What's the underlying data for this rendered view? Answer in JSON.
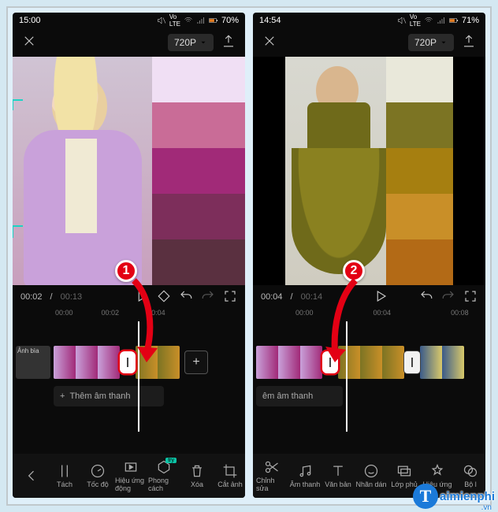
{
  "left": {
    "status": {
      "time": "15:00",
      "battery": "70%"
    },
    "header": {
      "resolution": "720P"
    },
    "swatches": [
      "#f0dff4",
      "#c96c97",
      "#a12a78",
      "#7d2e5b",
      "#5a3040"
    ],
    "ctrl": {
      "current": "00:02",
      "total": "00:13"
    },
    "ruler": [
      "00:00",
      "00:02",
      "00:04"
    ],
    "cover_label": "Ảnh bìa",
    "audio": "Thêm âm thanh",
    "tools": [
      {
        "label": "Tách"
      },
      {
        "label": "Tốc độ"
      },
      {
        "label": "Hiệu ứng động"
      },
      {
        "label": "Phong cách",
        "badge": "try"
      },
      {
        "label": "Xóa"
      },
      {
        "label": "Cắt ảnh"
      }
    ]
  },
  "right": {
    "status": {
      "time": "14:54",
      "battery": "71%"
    },
    "header": {
      "resolution": "720P"
    },
    "swatches": [
      "#e9e8da",
      "#7c7423",
      "#a67f10",
      "#c98f28",
      "#b36a16"
    ],
    "ctrl": {
      "current": "00:04",
      "total": "00:14"
    },
    "ruler": [
      "00:00",
      "00:04",
      "00:08"
    ],
    "audio": "êm âm thanh",
    "tools": [
      {
        "label": "Chỉnh sửa"
      },
      {
        "label": "Âm thanh"
      },
      {
        "label": "Văn bản"
      },
      {
        "label": "Nhãn dán"
      },
      {
        "label": "Lớp phủ"
      },
      {
        "label": "Hiệu ứng"
      },
      {
        "label": "Bộ l"
      }
    ]
  },
  "annotations": {
    "left": "1",
    "right": "2"
  },
  "watermark": {
    "brand": "aimienphi",
    "tld": ".vn"
  }
}
